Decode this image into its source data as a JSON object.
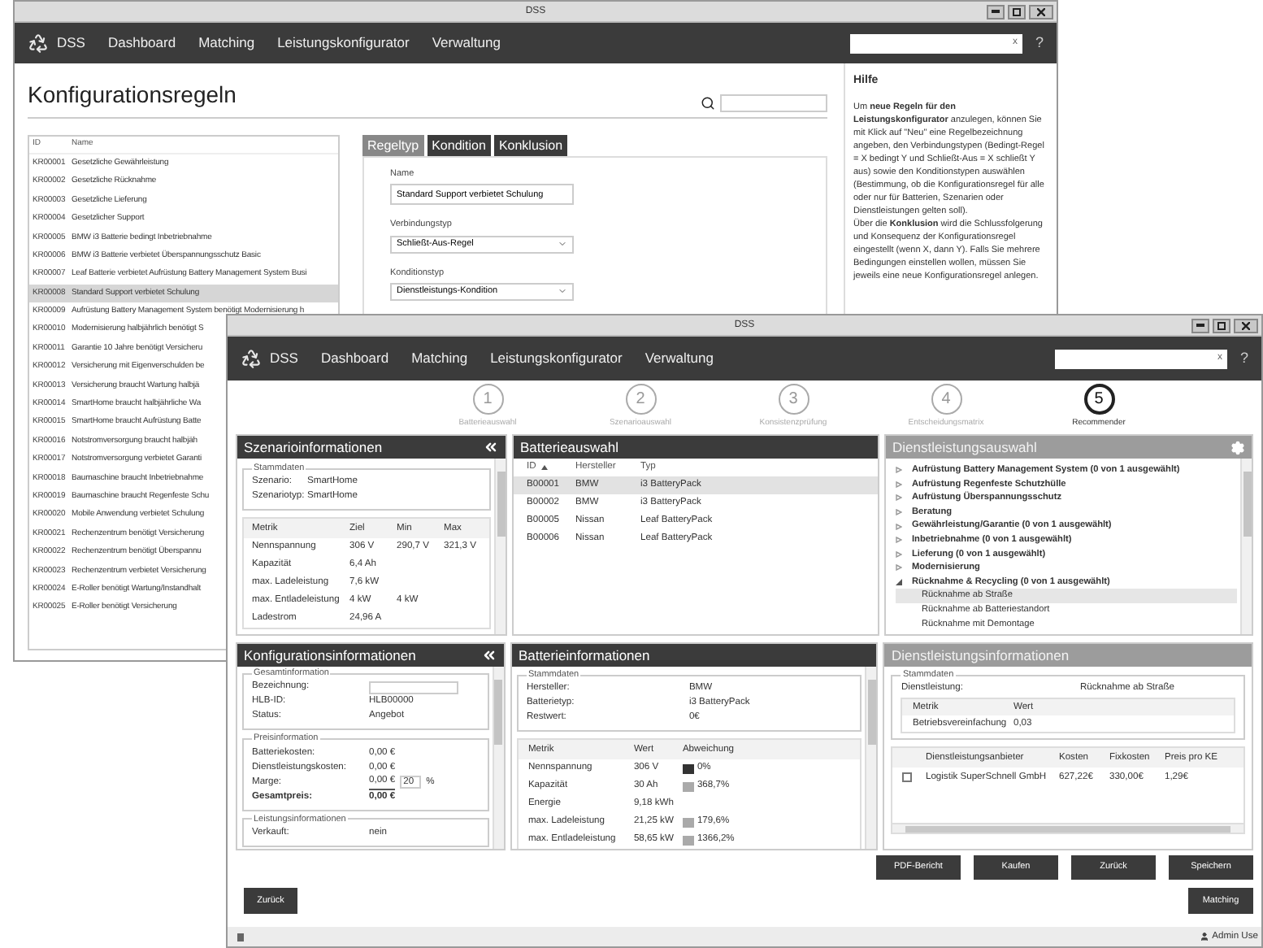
{
  "back_window": {
    "title": "DSS",
    "nav": {
      "brand": "DSS",
      "items": [
        "Dashboard",
        "Matching",
        "Leistungskonfigurator",
        "Verwaltung"
      ],
      "search_clear": "x",
      "help": "?"
    },
    "heading": "Konfigurationsregeln",
    "list": {
      "columns": [
        "ID",
        "Name"
      ],
      "rows": [
        {
          "id": "KR00001",
          "name": "Gesetzliche Gewährleistung",
          "selected": false
        },
        {
          "id": "KR00002",
          "name": "Gesetzliche Rücknahme",
          "selected": false
        },
        {
          "id": "KR00003",
          "name": "Gesetzliche Lieferung",
          "selected": false
        },
        {
          "id": "KR00004",
          "name": "Gesetzlicher Support",
          "selected": false
        },
        {
          "id": "KR00005",
          "name": "BMW i3 Batterie bedingt Inbetriebnahme",
          "selected": false
        },
        {
          "id": "KR00006",
          "name": "BMW i3 Batterie verbietet Überspannungsschutz Basic",
          "selected": false
        },
        {
          "id": "KR00007",
          "name": "Leaf Batterie verbietet Aufrüstung Battery Management System Busi",
          "selected": false
        },
        {
          "id": "KR00008",
          "name": "Standard Support verbietet Schulung",
          "selected": true
        },
        {
          "id": "KR00009",
          "name": "Aufrüstung Battery Management System benötigt Modernisierung h",
          "selected": false
        },
        {
          "id": "KR00010",
          "name": "Modernisierung halbjährlich benötigt S",
          "selected": false
        },
        {
          "id": "KR00011",
          "name": "Garantie 10 Jahre benötigt Versicheru",
          "selected": false
        },
        {
          "id": "KR00012",
          "name": "Versicherung mit Eigenverschulden be",
          "selected": false
        },
        {
          "id": "KR00013",
          "name": "Versicherung braucht Wartung halbjä",
          "selected": false
        },
        {
          "id": "KR00014",
          "name": "SmartHome braucht halbjährliche Wa",
          "selected": false
        },
        {
          "id": "KR00015",
          "name": "SmartHome braucht Aufrüstung Batte",
          "selected": false
        },
        {
          "id": "KR00016",
          "name": "Notstromversorgung braucht halbjäh",
          "selected": false
        },
        {
          "id": "KR00017",
          "name": "Notstromversorgung verbietet Garanti",
          "selected": false
        },
        {
          "id": "KR00018",
          "name": "Baumaschine braucht Inbetriebnahme",
          "selected": false
        },
        {
          "id": "KR00019",
          "name": "Baumaschine braucht Regenfeste Schu",
          "selected": false
        },
        {
          "id": "KR00020",
          "name": "Mobile Anwendung verbietet Schulung",
          "selected": false
        },
        {
          "id": "KR00021",
          "name": "Rechenzentrum benötigt Versicherung",
          "selected": false
        },
        {
          "id": "KR00022",
          "name": "Rechenzentrum benötigt Überspannu",
          "selected": false
        },
        {
          "id": "KR00023",
          "name": "Rechenzentrum verbietet Versicherung",
          "selected": false
        },
        {
          "id": "KR00024",
          "name": "E-Roller benötigt Wartung/Instandhalt",
          "selected": false
        },
        {
          "id": "KR00025",
          "name": "E-Roller benötigt Versicherung",
          "selected": false
        }
      ]
    },
    "tabs": [
      {
        "label": "Regeltyp",
        "selected": true
      },
      {
        "label": "Kondition",
        "selected": false
      },
      {
        "label": "Konklusion",
        "selected": false
      }
    ],
    "form": [
      {
        "label": "Name",
        "kind": "text",
        "value": "Standard Support verbietet Schulung"
      },
      {
        "label": "Verbindungstyp",
        "kind": "select",
        "value": "Schließt-Aus-Regel"
      },
      {
        "label": "Konditionstyp",
        "kind": "select",
        "value": "Dienstleistungs-Kondition"
      }
    ],
    "help": {
      "title": "Hilfe",
      "paragraphs": [
        "Um **neue Regeln für den Leistungskonfigurator** anzulegen, können Sie mit Klick auf \"Neu\" eine Regelbezeichnung angeben, den Verbindungstypen (Bedingt-Regel = X bedingt Y und Schließt-Aus = X schließt Y aus) sowie den Konditionstypen auswählen (Bestimmung, ob die Konfigurationsregel für alle oder nur für Batterien, Szenarien oder Dienstleistungen gelten soll).",
        "Über die **Konklusion** wird die Schlussfolgerung und Konsequenz der Konfigurationsregel eingestellt (wenn X, dann Y). Falls Sie mehrere Bedingungen einstellen wollen, müssen Sie jeweils eine neue Konfigurationsregel anlegen."
      ]
    }
  },
  "front_window": {
    "title": "DSS",
    "nav": {
      "brand": "DSS",
      "items": [
        "Dashboard",
        "Matching",
        "Leistungskonfigurator",
        "Verwaltung"
      ],
      "search_clear": "x",
      "help": "?"
    },
    "steps": [
      {
        "number": "1",
        "label": "Batterieauswahl",
        "selected": false
      },
      {
        "number": "2",
        "label": "Szenarioauswahl",
        "selected": false
      },
      {
        "number": "3",
        "label": "Konsistenzprüfung",
        "selected": false
      },
      {
        "number": "4",
        "label": "Entscheidungsmatrix",
        "selected": false
      },
      {
        "number": "5",
        "label": "Recommender",
        "selected": true
      }
    ],
    "scenario_panel": {
      "title": "Szenarioinformationen",
      "active": true,
      "group": {
        "title": "Stammdaten",
        "fields": [
          {
            "label": "Szenario:",
            "value": "SmartHome"
          },
          {
            "label": "Szenariotyp:",
            "value": "SmartHome"
          }
        ]
      },
      "table": {
        "columns": [
          "Metrik",
          "Ziel",
          "Min",
          "Max"
        ],
        "rows": [
          [
            "Nennspannung",
            "306 V",
            "290,7 V",
            "321,3 V"
          ],
          [
            "Kapazität",
            "6,4 Ah",
            "",
            ""
          ],
          [
            "max. Ladeleistung",
            "7,6 kW",
            "",
            ""
          ],
          [
            "max. Entladeleistung",
            "4 kW",
            "4 kW",
            ""
          ],
          [
            "Ladestrom",
            "24,96 A",
            "",
            ""
          ]
        ]
      }
    },
    "battery_select_panel": {
      "title": "Batterieauswahl",
      "active": true,
      "columns": [
        "ID",
        "Hersteller",
        "Typ"
      ],
      "rows": [
        {
          "cells": [
            "B00001",
            "BMW",
            "i3 BatteryPack"
          ],
          "selected": true
        },
        {
          "cells": [
            "B00002",
            "BMW",
            "i3 BatteryPack"
          ],
          "selected": false
        },
        {
          "cells": [
            "B00005",
            "Nissan",
            "Leaf BatteryPack"
          ],
          "selected": false
        },
        {
          "cells": [
            "B00006",
            "Nissan",
            "Leaf BatteryPack"
          ],
          "selected": false
        }
      ]
    },
    "service_select_panel": {
      "title": "Dienstleistungsauswahl",
      "active": false,
      "tree": [
        {
          "label": "Aufrüstung Battery Management System (0 von 1 ausgewählt)",
          "expanded": false
        },
        {
          "label": "Aufrüstung Regenfeste Schutzhülle",
          "expanded": false
        },
        {
          "label": "Aufrüstung Überspannungsschutz",
          "expanded": false
        },
        {
          "label": "Beratung",
          "expanded": false
        },
        {
          "label": "Gewährleistung/Garantie (0 von 1 ausgewählt)",
          "expanded": false
        },
        {
          "label": "Inbetriebnahme (0 von 1 ausgewählt)",
          "expanded": false
        },
        {
          "label": "Lieferung (0 von 1 ausgewählt)",
          "expanded": false
        },
        {
          "label": "Modernisierung",
          "expanded": false
        },
        {
          "label": "Rücknahme & Recycling (0 von 1 ausgewählt)",
          "expanded": true,
          "children": [
            {
              "label": "Rücknahme ab Straße",
              "selected": true
            },
            {
              "label": "Rücknahme ab Batteriestandort",
              "selected": false
            },
            {
              "label": "Rücknahme mit Demontage",
              "selected": false
            }
          ]
        }
      ]
    },
    "config_panel": {
      "title": "Konfigurationsinformationen",
      "active": true,
      "groups": [
        {
          "title": "Gesamtinformation",
          "fields": [
            {
              "label": "Bezeichnung:",
              "kind": "input"
            },
            {
              "label": "HLB-ID:",
              "kind": "text",
              "value": "HLB00000"
            },
            {
              "label": "Status:",
              "kind": "text",
              "value": "Angebot"
            }
          ]
        },
        {
          "title": "Preisinformation",
          "fields": [
            {
              "label": "Batteriekosten:",
              "kind": "text",
              "value": "0,00 €"
            },
            {
              "label": "Dienstleistungskosten:",
              "kind": "text",
              "value": "0,00 €"
            },
            {
              "label": "Marge:",
              "kind": "margin",
              "value": "0,00 €",
              "input": "20",
              "unit": "%"
            },
            {
              "label": "Gesamtpreis:",
              "kind": "total",
              "value": "0,00 €"
            }
          ]
        },
        {
          "title": "Leistungsinformationen",
          "fields": [
            {
              "label": "Verkauft:",
              "kind": "text",
              "value": "nein"
            }
          ]
        }
      ]
    },
    "battery_info_panel": {
      "title": "Batterieinformationen",
      "active": true,
      "group": {
        "title": "Stammdaten",
        "fields": [
          {
            "label": "Hersteller:",
            "value": "BMW"
          },
          {
            "label": "Batterietyp:",
            "value": "i3 BatteryPack"
          },
          {
            "label": "Restwert:",
            "value": "0€"
          }
        ]
      },
      "columns": [
        "Metrik",
        "Wert",
        "Abweichung"
      ],
      "rows": [
        {
          "metric": "Nennspannung",
          "value": "306 V",
          "color": "#333333",
          "deviation": "0%"
        },
        {
          "metric": "Kapazität",
          "value": "30 Ah",
          "color": "#aaaaaa",
          "deviation": "368,7%"
        },
        {
          "metric": "Energie",
          "value": "9,18 kWh"
        },
        {
          "metric": "max. Ladeleistung",
          "value": "21,25 kW",
          "color": "#aaaaaa",
          "deviation": "179,6%"
        },
        {
          "metric": "max. Entladeleistung",
          "value": "58,65 kW",
          "color": "#aaaaaa",
          "deviation": "1366,2%"
        }
      ]
    },
    "service_info_panel": {
      "title": "Dienstleistungsinformationen",
      "active": false,
      "group": {
        "title": "Stammdaten",
        "fields": [
          {
            "label": "Dienstleistung:",
            "value": "Rücknahme ab Straße"
          }
        ],
        "columns": [
          "Metrik",
          "Wert"
        ],
        "rows": [
          [
            "Betriebsvereinfachung",
            "0,03"
          ]
        ]
      },
      "providers": {
        "columns": [
          "Dienstleistungsanbieter",
          "Kosten",
          "Fixkosten",
          "Preis pro KE"
        ],
        "rows": [
          {
            "checked": false,
            "cells": [
              "Logistik SuperSchnell GmbH",
              "627,22€",
              "330,00€",
              "1,29€"
            ]
          }
        ]
      }
    },
    "actions": [
      "PDF-Bericht",
      "Kaufen",
      "Zurück",
      "Speichern"
    ],
    "secondary_action": "Matching",
    "back_button": "Zurück",
    "status_bar": {
      "user": "Admin Use"
    }
  }
}
